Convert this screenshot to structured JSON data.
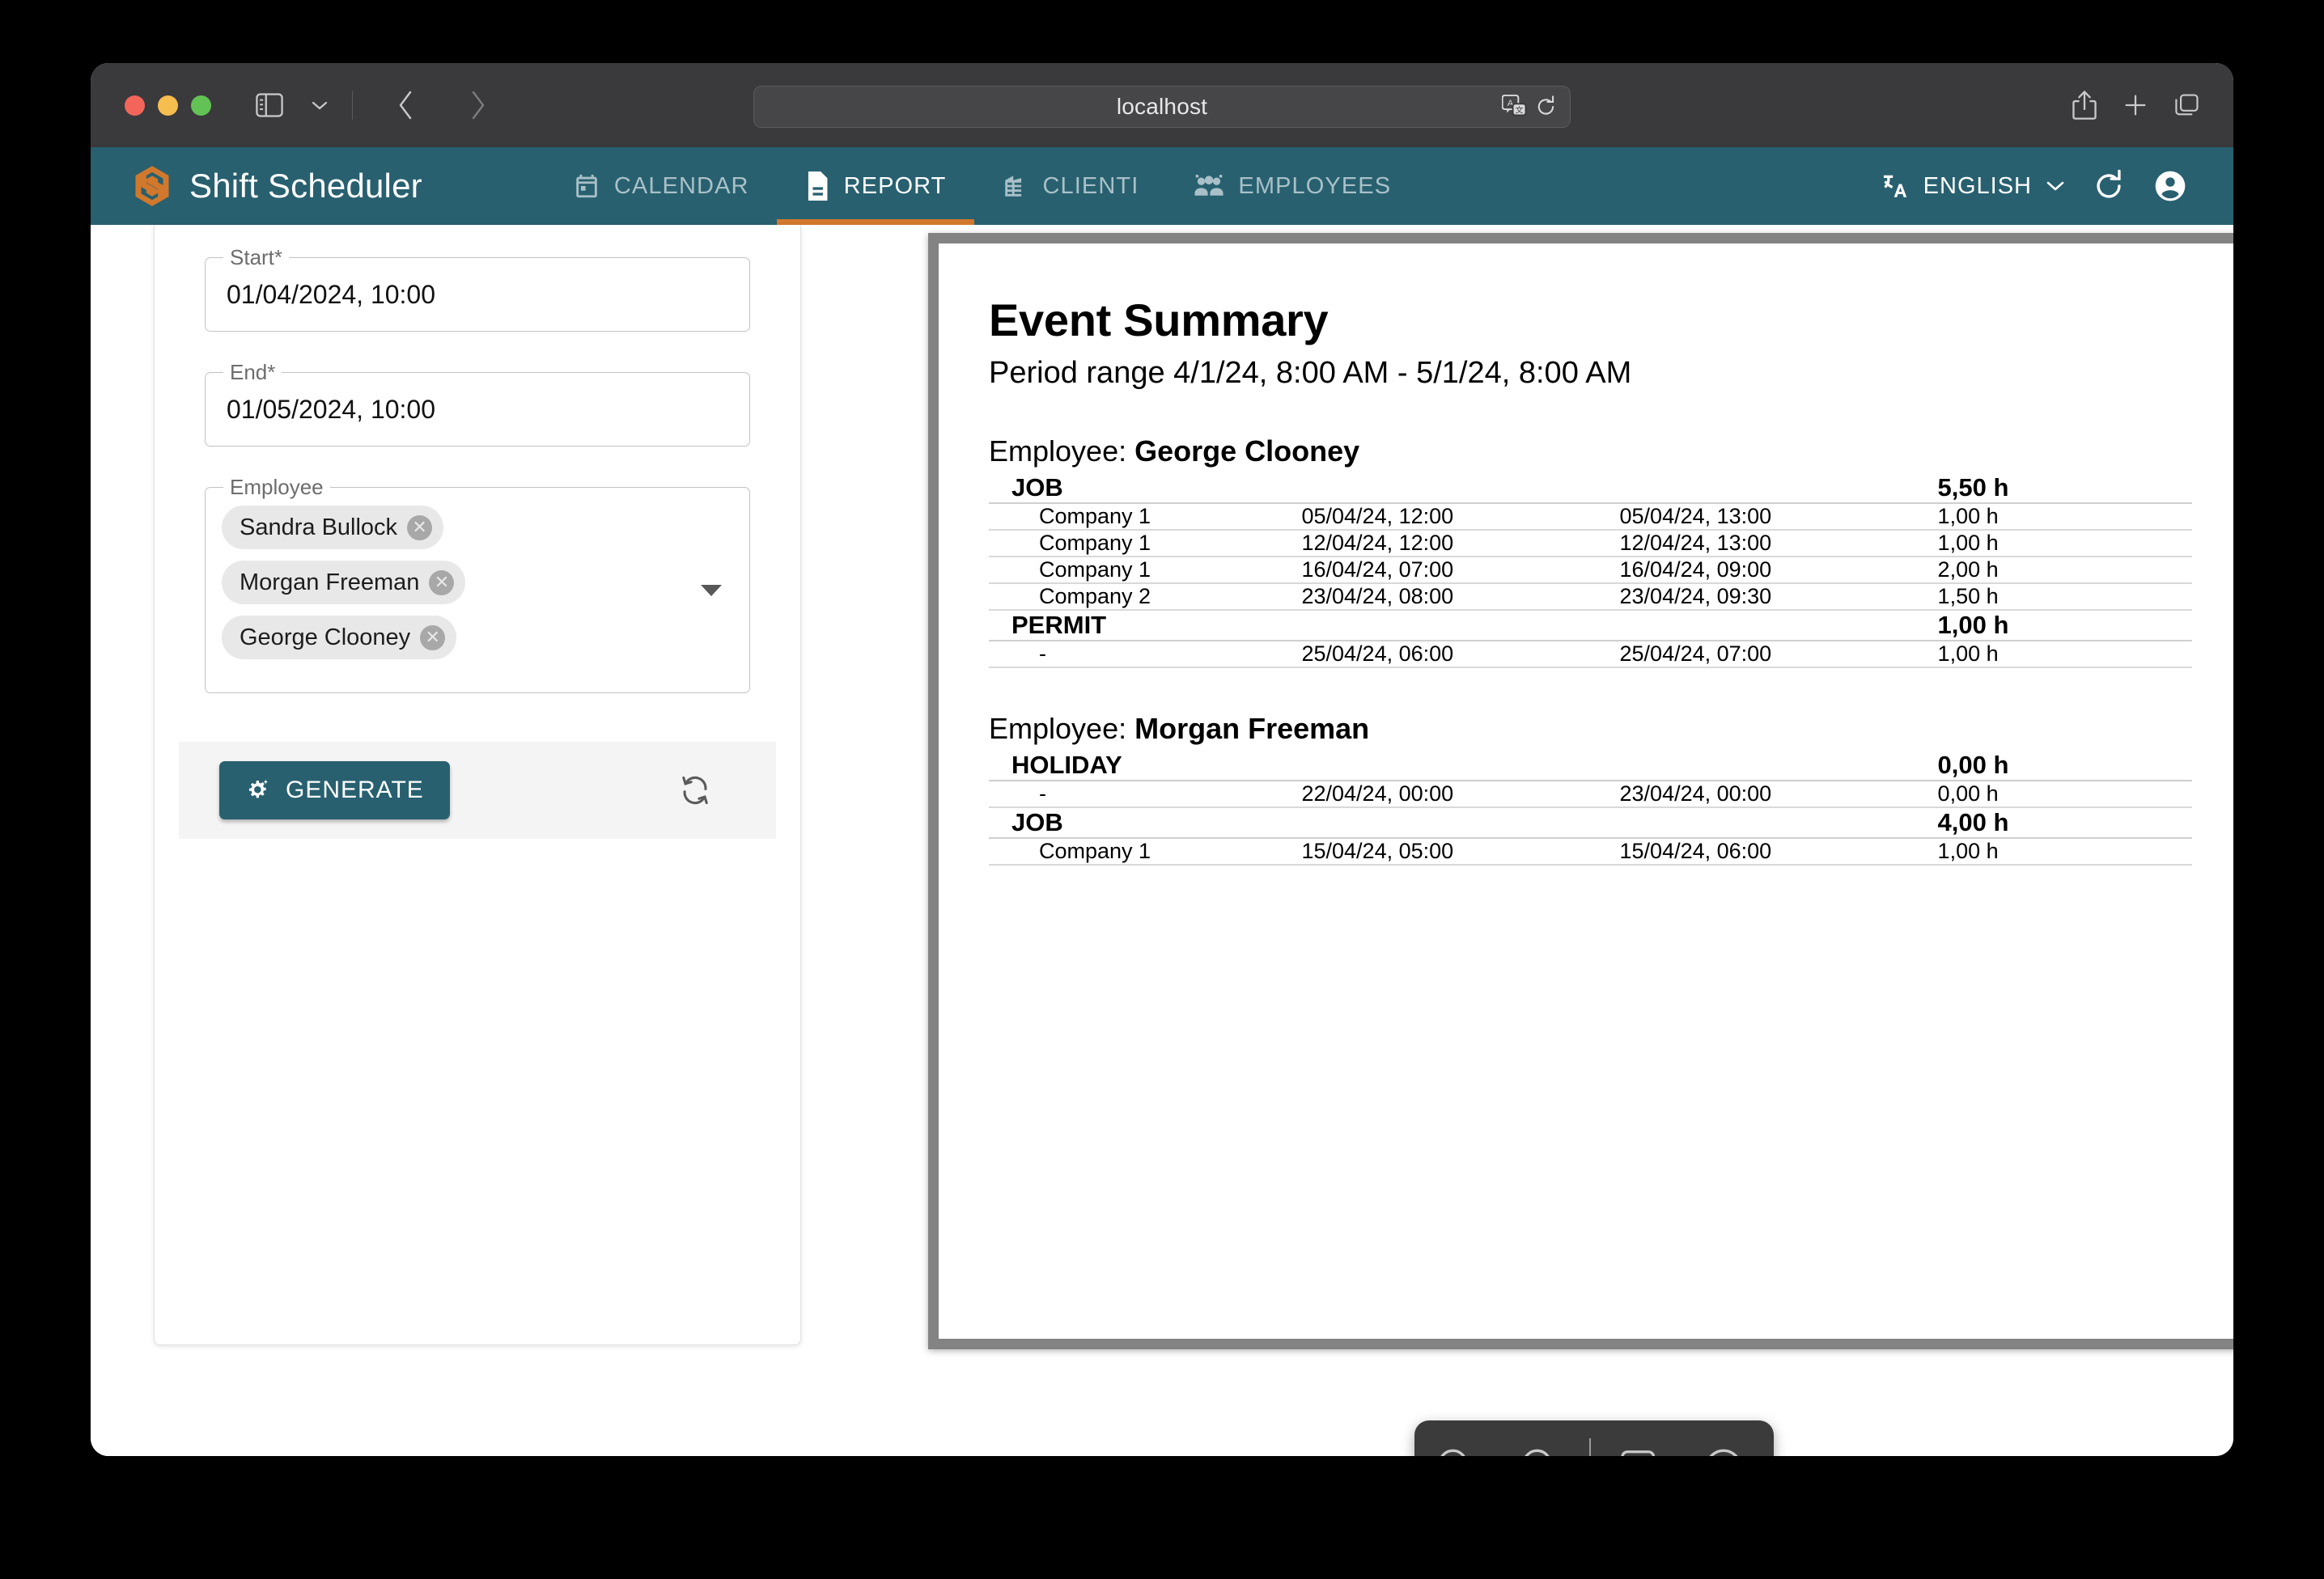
{
  "browser": {
    "url": "localhost",
    "traffic_lights": [
      "close",
      "minimize",
      "zoom"
    ],
    "toolbar_icons": [
      "sidebar-icon",
      "chevron-down-icon",
      "back-icon",
      "forward-icon"
    ],
    "address_icons": [
      "translate-icon",
      "reload-icon"
    ],
    "right_icons": [
      "share-icon",
      "new-tab-icon",
      "tab-overview-icon"
    ]
  },
  "app": {
    "brand": "Shift Scheduler",
    "brand_icon": "hexagon-s-logo",
    "accent": "#28606f",
    "accent_orange": "#d1782c",
    "tabs": [
      {
        "label": "CALENDAR",
        "icon": "calendar-icon",
        "active": false
      },
      {
        "label": "REPORT",
        "icon": "document-icon",
        "active": true
      },
      {
        "label": "CLIENTI",
        "icon": "building-icon",
        "active": false
      },
      {
        "label": "EMPLOYEES",
        "icon": "people-icon",
        "active": false
      }
    ],
    "language": {
      "label": "ENGLISH",
      "icon": "translate-icon"
    },
    "refresh_icon": "refresh-icon",
    "account_icon": "account-circle-icon"
  },
  "form": {
    "start": {
      "label": "Start",
      "required": "*",
      "value": "01/04/2024, 10:00"
    },
    "end": {
      "label": "End",
      "required": "*",
      "value": "01/05/2024, 10:00"
    },
    "employee": {
      "label": "Employee",
      "chips": [
        "Sandra Bullock",
        "Morgan Freeman",
        "George Clooney"
      ],
      "remove_glyph": "✕"
    },
    "generate_button": {
      "label": "GENERATE",
      "icon": "auto-fix-gear-icon"
    },
    "reset_icon": "reset-icon"
  },
  "report": {
    "title": "Event Summary",
    "subtitle": "Period range 4/1/24, 8:00 AM - 5/1/24, 8:00 AM",
    "employee_prefix": "Employee:",
    "employees": [
      {
        "name": "George Clooney",
        "categories": [
          {
            "name": "JOB",
            "total": "5,50 h",
            "rows": [
              {
                "client": "Company 1",
                "start": "05/04/24, 12:00",
                "end": "05/04/24, 13:00",
                "hours": "1,00 h"
              },
              {
                "client": "Company 1",
                "start": "12/04/24, 12:00",
                "end": "12/04/24, 13:00",
                "hours": "1,00 h"
              },
              {
                "client": "Company 1",
                "start": "16/04/24, 07:00",
                "end": "16/04/24, 09:00",
                "hours": "2,00 h"
              },
              {
                "client": "Company 2",
                "start": "23/04/24, 08:00",
                "end": "23/04/24, 09:30",
                "hours": "1,50 h"
              }
            ]
          },
          {
            "name": "PERMIT",
            "total": "1,00 h",
            "rows": [
              {
                "client": "-",
                "start": "25/04/24, 06:00",
                "end": "25/04/24, 07:00",
                "hours": "1,00 h"
              }
            ]
          }
        ]
      },
      {
        "name": "Morgan Freeman",
        "categories": [
          {
            "name": "HOLIDAY",
            "total": "0,00 h",
            "rows": [
              {
                "client": "-",
                "start": "22/04/24, 00:00",
                "end": "23/04/24, 00:00",
                "hours": "0,00 h"
              }
            ]
          },
          {
            "name": "JOB",
            "total": "4,00 h",
            "rows": [
              {
                "client": "Company 1",
                "start": "15/04/24, 05:00",
                "end": "15/04/24, 06:00",
                "hours": "1,00 h"
              }
            ]
          }
        ]
      }
    ]
  },
  "pdf_toolbar": {
    "buttons": [
      {
        "name": "zoom-out-icon"
      },
      {
        "name": "zoom-in-icon"
      },
      {
        "name": "markup-icon"
      },
      {
        "name": "download-icon"
      }
    ]
  }
}
